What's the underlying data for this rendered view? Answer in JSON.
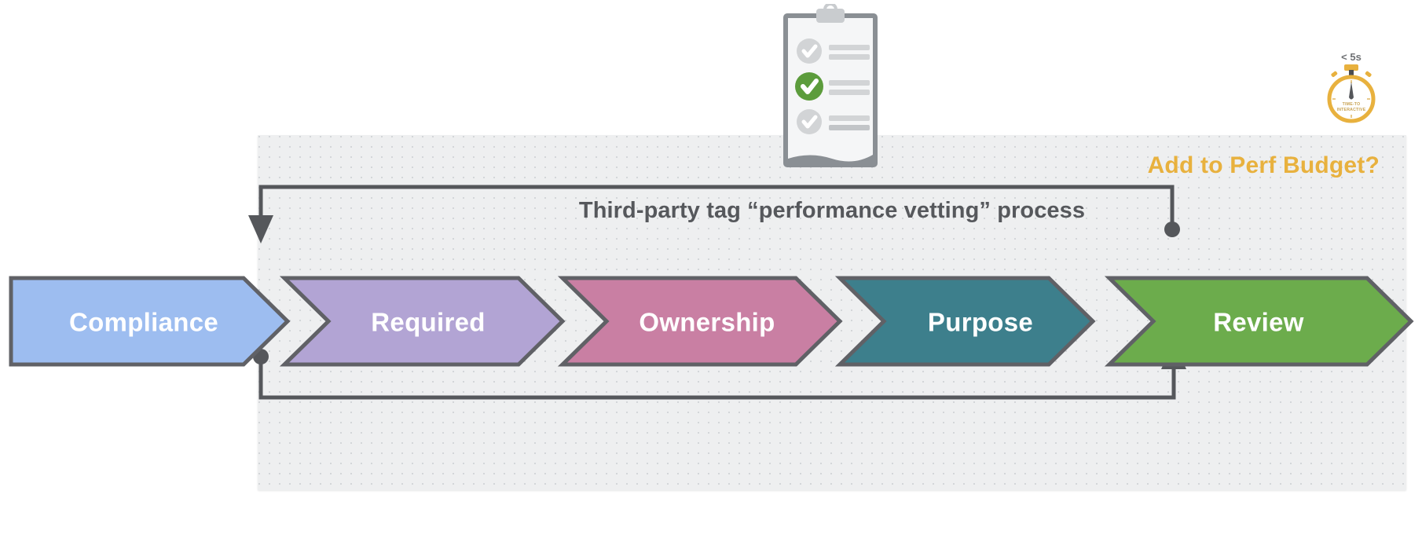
{
  "diagram": {
    "title": "Third-party tag “performance vetting” process",
    "perf_budget_label": "Add to Perf Budget?",
    "panel_background": "#eeeff0"
  },
  "stages": [
    {
      "id": "compliance",
      "label": "Compliance",
      "color": "#9dbdf0",
      "stroke": "#606166"
    },
    {
      "id": "required",
      "label": "Required",
      "color": "#b2a4d4",
      "stroke": "#606166"
    },
    {
      "id": "ownership",
      "label": "Ownership",
      "color": "#c97fa3",
      "stroke": "#606166"
    },
    {
      "id": "purpose",
      "label": "Purpose",
      "color": "#3d7f8c",
      "stroke": "#606166"
    },
    {
      "id": "review",
      "label": "Review",
      "color": "#6cac4c",
      "stroke": "#606166"
    }
  ],
  "stopwatch": {
    "threshold_label": "< 5s",
    "metric_line1": "TIME-TO",
    "metric_line2": "INTERACTIVE",
    "color": "#e8b13e"
  },
  "clipboard": {
    "items": [
      {
        "state": "pending",
        "check_color": "#d2d4d6"
      },
      {
        "state": "complete",
        "check_color": "#5c9c3c"
      },
      {
        "state": "pending",
        "check_color": "#d2d4d6"
      }
    ],
    "board_color": "#8a8f94",
    "paper_color": "#f4f5f6"
  },
  "loops": {
    "top_flow_direction": "right-to-left",
    "bottom_flow_direction": "left-to-right",
    "line_color": "#55575b"
  },
  "colors": {
    "accent_amber": "#e8b13e",
    "title_gray": "#56585c",
    "line_gray": "#55575b"
  }
}
